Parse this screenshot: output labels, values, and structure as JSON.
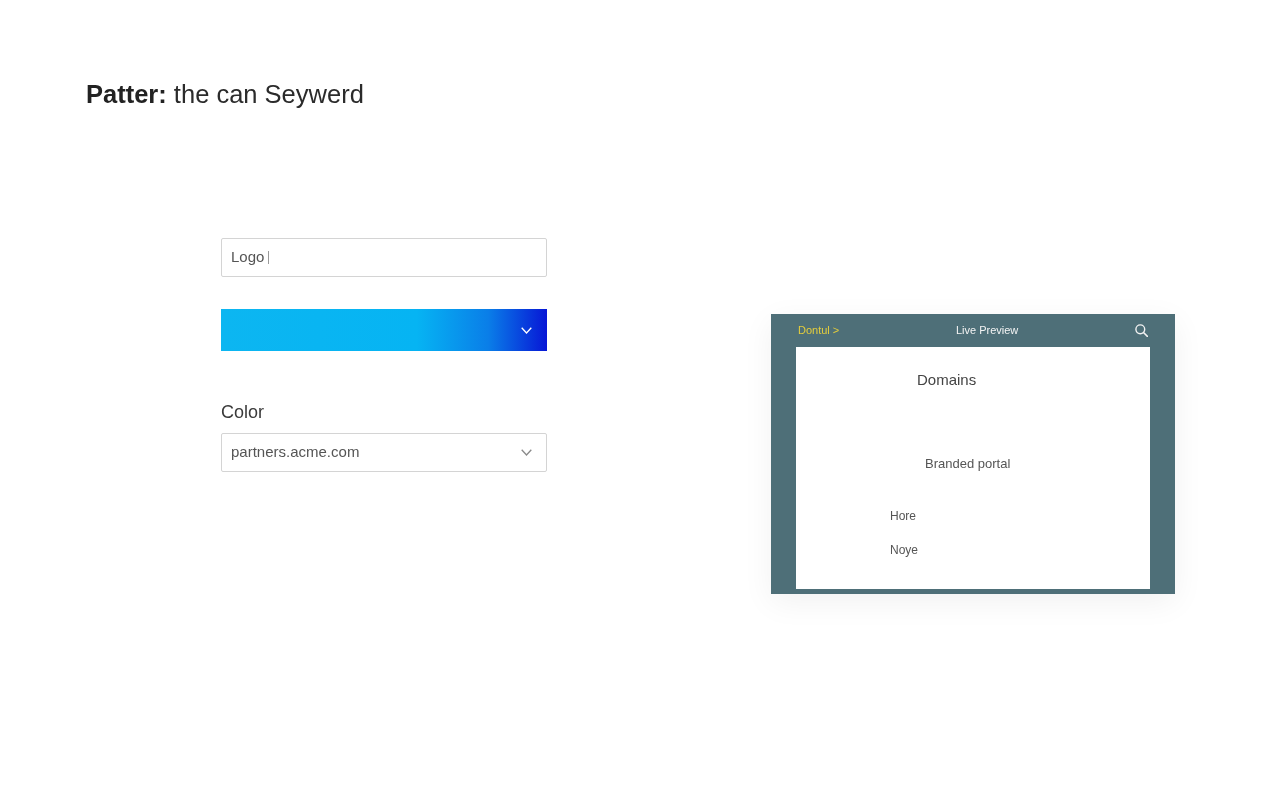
{
  "page_title": "**Patter:** the can Seywerd",
  "form_fields": [
    {
      "kind": "text",
      "value": "Logo",
      "focused": true
    },
    {
      "kind": "gradient"
    },
    {
      "kind": "select",
      "label": "Color",
      "value": "partners.acme.com"
    }
  ],
  "preview": {
    "breadcrumb": "Dontul >",
    "title": "Live Preview",
    "heading": "Domains",
    "subheading": "Branded portal",
    "items": [
      "Hore",
      "Noye"
    ]
  }
}
